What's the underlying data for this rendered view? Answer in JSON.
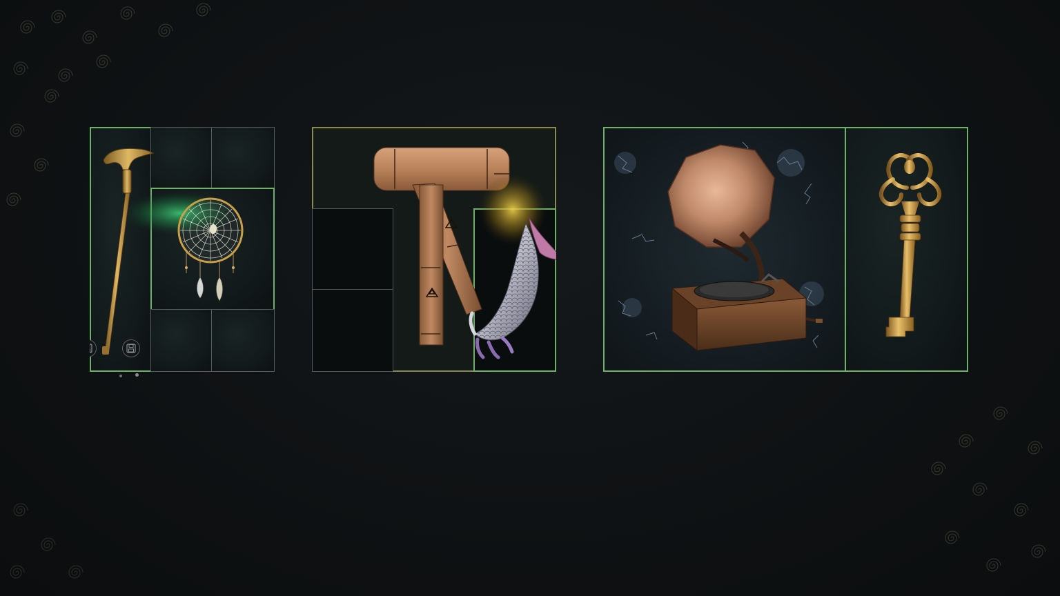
{
  "screen": {
    "title": ""
  },
  "panels": [
    {
      "id": "panel-1",
      "items": [
        {
          "name": "walking-cane",
          "icon": "golden-cane-icon"
        },
        {
          "name": "dreamcatcher",
          "icon": "spiderweb-dreamcatcher-icon"
        }
      ],
      "slot_icons": [
        "save-slot-icon",
        "save-slot-icon"
      ]
    },
    {
      "id": "panel-2",
      "items": [
        {
          "name": "wooden-mallet",
          "icon": "wooden-mallet-icon"
        },
        {
          "name": "scaled-glove",
          "icon": "scaled-gauntlet-icon"
        }
      ]
    },
    {
      "id": "panel-3",
      "items": [
        {
          "name": "gramophone",
          "icon": "gramophone-icon"
        },
        {
          "name": "ornate-key",
          "icon": "ornate-key-icon"
        }
      ]
    }
  ],
  "colors": {
    "background": "#0e1012",
    "highlight_border": "#6fb06a",
    "grid_line": "#aab4aa",
    "gold": "#c9a04a",
    "wood": "#b9825a",
    "copper": "#c08a6a",
    "green_glow": "#3fd07a",
    "yellow_glow": "#e8c23a"
  }
}
